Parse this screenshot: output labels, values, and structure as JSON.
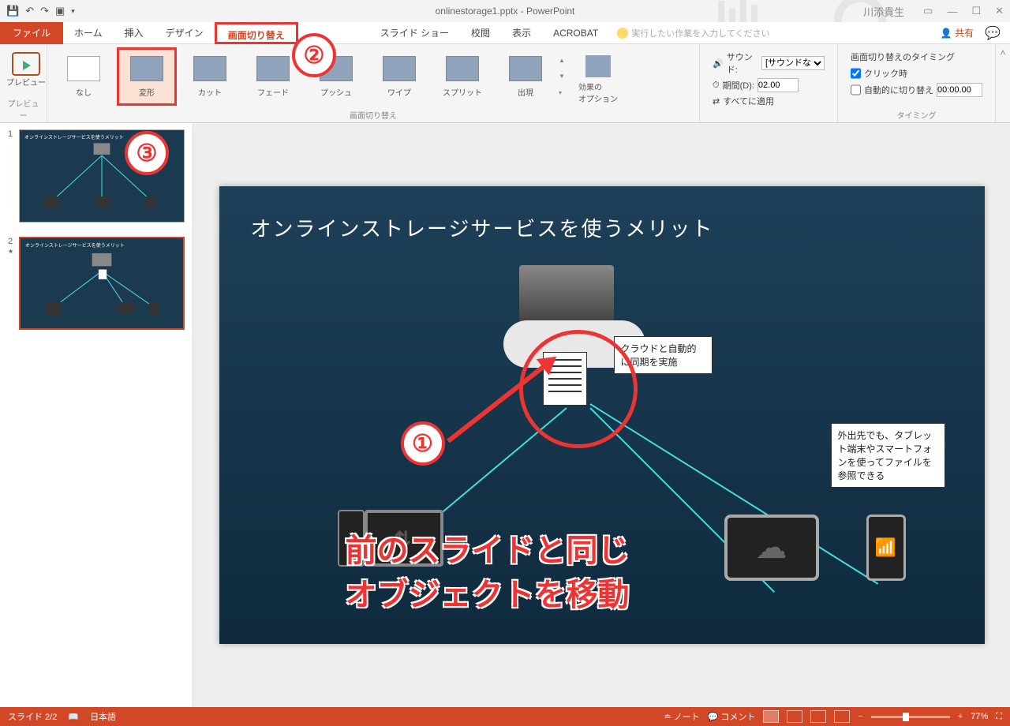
{
  "title": "onlinestorage1.pptx - PowerPoint",
  "user": "川添貴生",
  "tabs": {
    "file": "ファイル",
    "home": "ホーム",
    "insert": "挿入",
    "design": "デザイン",
    "transitions": "画面切り替え",
    "slideshow": "スライド ショー",
    "review": "校閲",
    "view": "表示",
    "acrobat": "ACROBAT"
  },
  "tellme": "実行したい作業を入力してください",
  "share": "共有",
  "ribbon": {
    "preview": "プレビュー",
    "transitions_group": "画面切り替え",
    "items": {
      "none": "なし",
      "morph": "変形",
      "cut": "カット",
      "fade": "フェード",
      "push": "プッシュ",
      "wipe": "ワイプ",
      "split": "スプリット",
      "reveal": "出現"
    },
    "effect_options": "効果の\nオプション",
    "sound": "サウンド:",
    "sound_val": "[サウンドなし]",
    "duration": "期間(D):",
    "duration_val": "02.00",
    "apply_all": "すべてに適用",
    "timing_title": "画面切り替えのタイミング",
    "on_click": "クリック時",
    "after": "自動的に切り替え",
    "after_val": "00:00.00",
    "timing_group": "タイミング"
  },
  "slide": {
    "title": "オンラインストレージサービスを使うメリット",
    "callout1": "クラウドと自動的に同期を実施",
    "callout2": "外出先でも、タブレット端末やスマートフォンを使ってファイルを参照できる",
    "redtext1": "前のスライドと同じ",
    "redtext2": "オブジェクトを移動"
  },
  "status": {
    "slide": "スライド 2/2",
    "lang": "日本語",
    "notes": "ノート",
    "comments": "コメント",
    "zoom": "77%"
  }
}
